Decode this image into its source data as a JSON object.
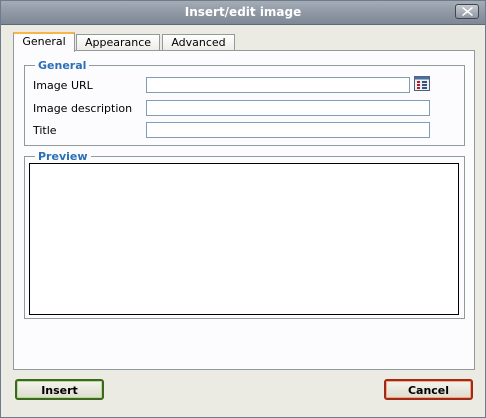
{
  "window": {
    "title": "Insert/edit image",
    "close_icon": "close-icon"
  },
  "tabs": [
    {
      "label": "General",
      "active": true
    },
    {
      "label": "Appearance",
      "active": false
    },
    {
      "label": "Advanced",
      "active": false
    }
  ],
  "general": {
    "legend": "General",
    "image_url": {
      "label": "Image URL",
      "value": ""
    },
    "image_description": {
      "label": "Image description",
      "value": ""
    },
    "title": {
      "label": "Title",
      "value": ""
    },
    "browse_icon": "browse-list-icon"
  },
  "preview": {
    "legend": "Preview"
  },
  "buttons": {
    "insert": "Insert",
    "cancel": "Cancel"
  },
  "colors": {
    "legend_text": "#2b6fb6",
    "active_tab_accent": "#f7b64a",
    "insert_border": "#3c6a1b",
    "cancel_border": "#a12b12",
    "titlebar": "#8f98a4"
  }
}
